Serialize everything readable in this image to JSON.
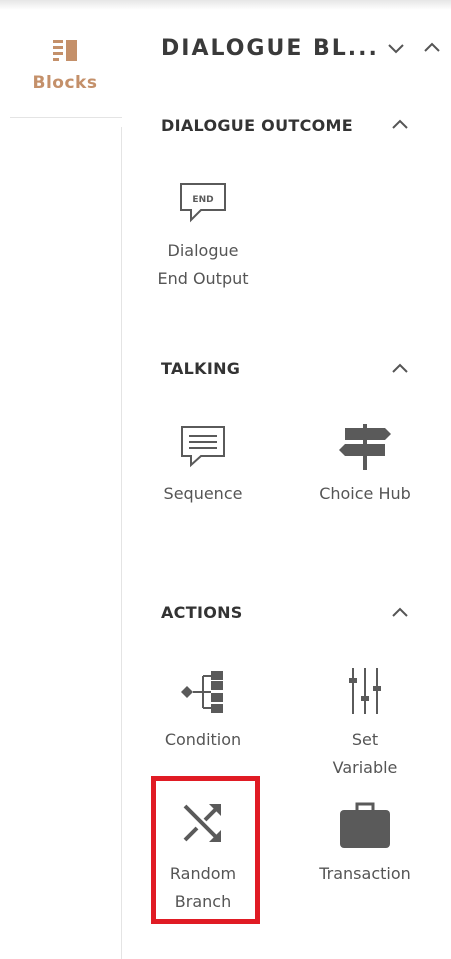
{
  "rail": {
    "tab_label": "Blocks",
    "tab_icon": "blocks-icon"
  },
  "panel": {
    "title": "DIALOGUE BL...",
    "collapse_icon": "chevron-down-icon",
    "expand_icon": "chevron-up-icon"
  },
  "sections": [
    {
      "title": "DIALOGUE OUTCOME",
      "blocks": [
        {
          "label_line1": "Dialogue",
          "label_line2": "End Output",
          "icon": "end-speech-bubble-icon",
          "icon_text": "END"
        }
      ]
    },
    {
      "title": "TALKING",
      "blocks": [
        {
          "label_line1": "Sequence",
          "icon": "speech-bubble-icon"
        },
        {
          "label_line1": "Choice Hub",
          "icon": "signpost-icon"
        }
      ]
    },
    {
      "title": "ACTIONS",
      "blocks": [
        {
          "label_line1": "Condition",
          "icon": "condition-tree-icon"
        },
        {
          "label_line1": "Set",
          "label_line2": "Variable",
          "icon": "sliders-icon"
        },
        {
          "label_line1": "Random",
          "label_line2": "Branch",
          "icon": "shuffle-icon",
          "highlighted": true
        },
        {
          "label_line1": "Transaction",
          "icon": "briefcase-icon"
        }
      ]
    }
  ],
  "colors": {
    "accent": "#c4906a",
    "highlight": "#e01b24",
    "icon": "#5a5a5a",
    "text": "#555555"
  }
}
